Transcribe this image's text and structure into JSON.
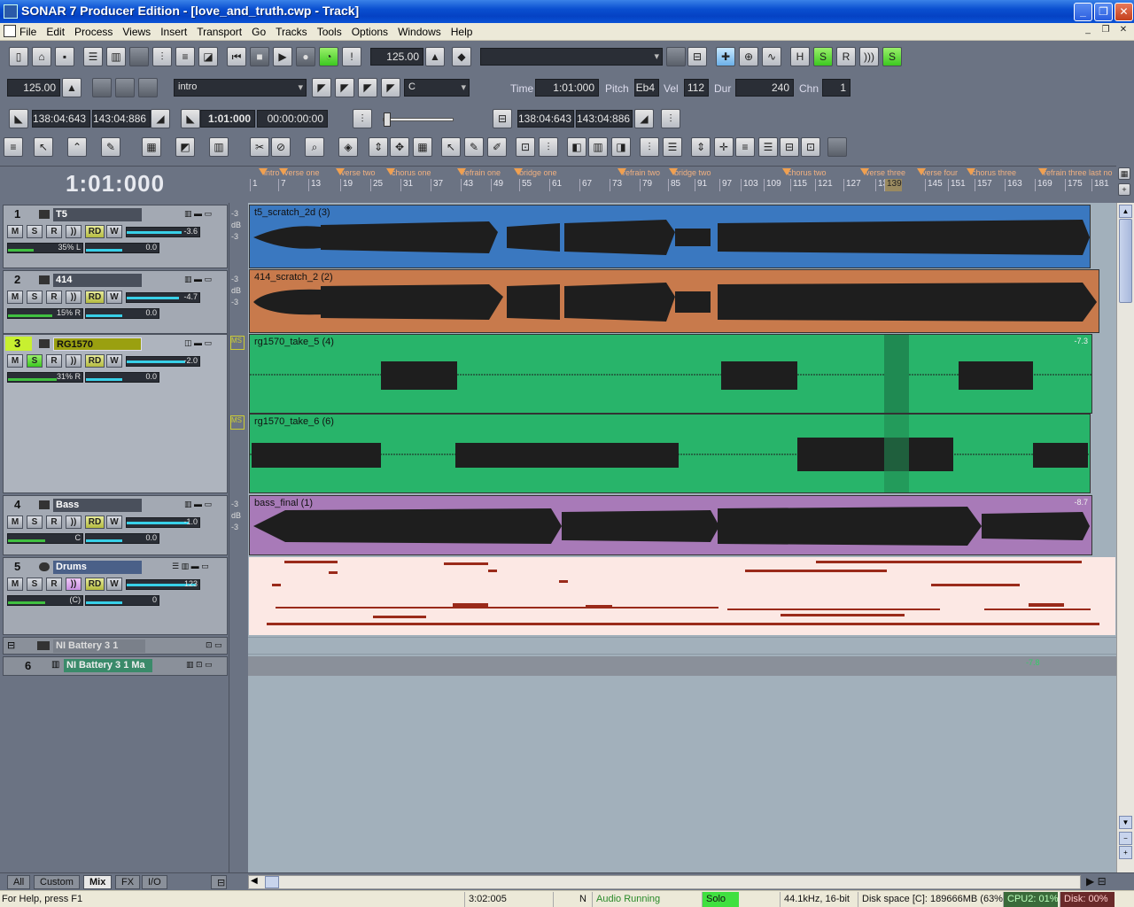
{
  "window": {
    "title": "SONAR 7 Producer Edition - [love_and_truth.cwp - Track]"
  },
  "menu": [
    "File",
    "Edit",
    "Process",
    "Views",
    "Insert",
    "Transport",
    "Go",
    "Tracks",
    "Tools",
    "Options",
    "Windows",
    "Help"
  ],
  "toolbar": {
    "tempo_top": "125.00",
    "tempo": "125.00",
    "marker_dropdown": "intro",
    "key_dropdown": "C",
    "time_label": "Time",
    "time_value": "1:01:000",
    "pitch_label": "Pitch",
    "pitch_value": "Eb4",
    "vel_label": "Vel",
    "vel_value": "112",
    "dur_label": "Dur",
    "dur_value": "240",
    "chn_label": "Chn",
    "chn_value": "1",
    "loop_start": "138:04:643",
    "loop_end": "143:04:886",
    "now_mbt": "1:01:000",
    "now_smpte": "00:00:00:00",
    "punch_start": "138:04:643",
    "punch_end": "143:04:886"
  },
  "now_time": "1:01:000",
  "markers": [
    "intro",
    "verse one",
    "verse two",
    "chorus one",
    "refrain one",
    "bridge one",
    "refrain two",
    "bridge two",
    "chorus two",
    "verse three",
    "verse four",
    "chorus three",
    "refrain three last no"
  ],
  "bars": [
    "1",
    "7",
    "13",
    "19",
    "25",
    "31",
    "37",
    "43",
    "49",
    "55",
    "61",
    "67",
    "73",
    "79",
    "85",
    "91",
    "97",
    "103",
    "109",
    "115",
    "121",
    "127",
    "133",
    "139",
    "145",
    "151",
    "157",
    "163",
    "169",
    "175",
    "181"
  ],
  "tracks": [
    {
      "num": "1",
      "name": "T5",
      "vol": "-3.6",
      "pan": "35% L",
      "gain": "0.0",
      "vol_level": 0.75,
      "pan_level": 0.35
    },
    {
      "num": "2",
      "name": "414",
      "vol": "-4.7",
      "pan": "15% R",
      "gain": "0.0",
      "vol_level": 0.72,
      "pan_level": 0.6
    },
    {
      "num": "3",
      "name": "RG1570",
      "vol": "-2.0",
      "pan": "31% R",
      "gain": "0.0",
      "vol_level": 0.8,
      "pan_level": 0.65
    },
    {
      "num": "4",
      "name": "Bass",
      "vol": "-1.0",
      "pan": "C",
      "gain": "0.0",
      "vol_level": 0.85,
      "pan_level": 0.5
    },
    {
      "num": "5",
      "name": "Drums",
      "vol": "123",
      "pan": "(C)",
      "gain": "0",
      "vol_level": 0.95,
      "pan_level": 0.5
    },
    {
      "num": "",
      "name": "NI Battery 3 1"
    },
    {
      "num": "6",
      "name": "NI Battery 3 1 Ma"
    }
  ],
  "track_buttons": {
    "mute": "M",
    "solo": "S",
    "record": "R",
    "input": "))",
    "read": "RD",
    "write": "W"
  },
  "scale_labels": {
    "top": "-3",
    "mid": "dB",
    "bot": "-3",
    "ms": "MS"
  },
  "clips": {
    "t5": "t5_scratch_2d (3)",
    "c414": "414_scratch_2 (2)",
    "rg5": "rg1570_take_5 (4)",
    "rg6": "rg1570_take_6 (6)",
    "bass": "bass_final (1)"
  },
  "clip_level_labels": {
    "rg": "-7.3",
    "bass": "-8.7",
    "battery": "-7.8"
  },
  "bottom_tabs": [
    "All",
    "Custom",
    "Mix",
    "FX",
    "I/O"
  ],
  "status": {
    "help": "For Help, press F1",
    "time": "3:02:005",
    "n": "N",
    "audio": "Audio Running",
    "solo": "Solo",
    "format": "44.1kHz, 16-bit",
    "disk_space": "Disk space [C]: 189666MB (63%)",
    "cpu": "CPU2: 01%",
    "disk": "Disk: 00%"
  },
  "colors": {
    "t5_clip": "#3a78c0",
    "c414_clip": "#c87a4c",
    "rg_clip": "#28b46a",
    "bass_clip": "#a87ab8",
    "drums_clip": "#fce8e4",
    "midi_note": "#9a2a1a"
  }
}
